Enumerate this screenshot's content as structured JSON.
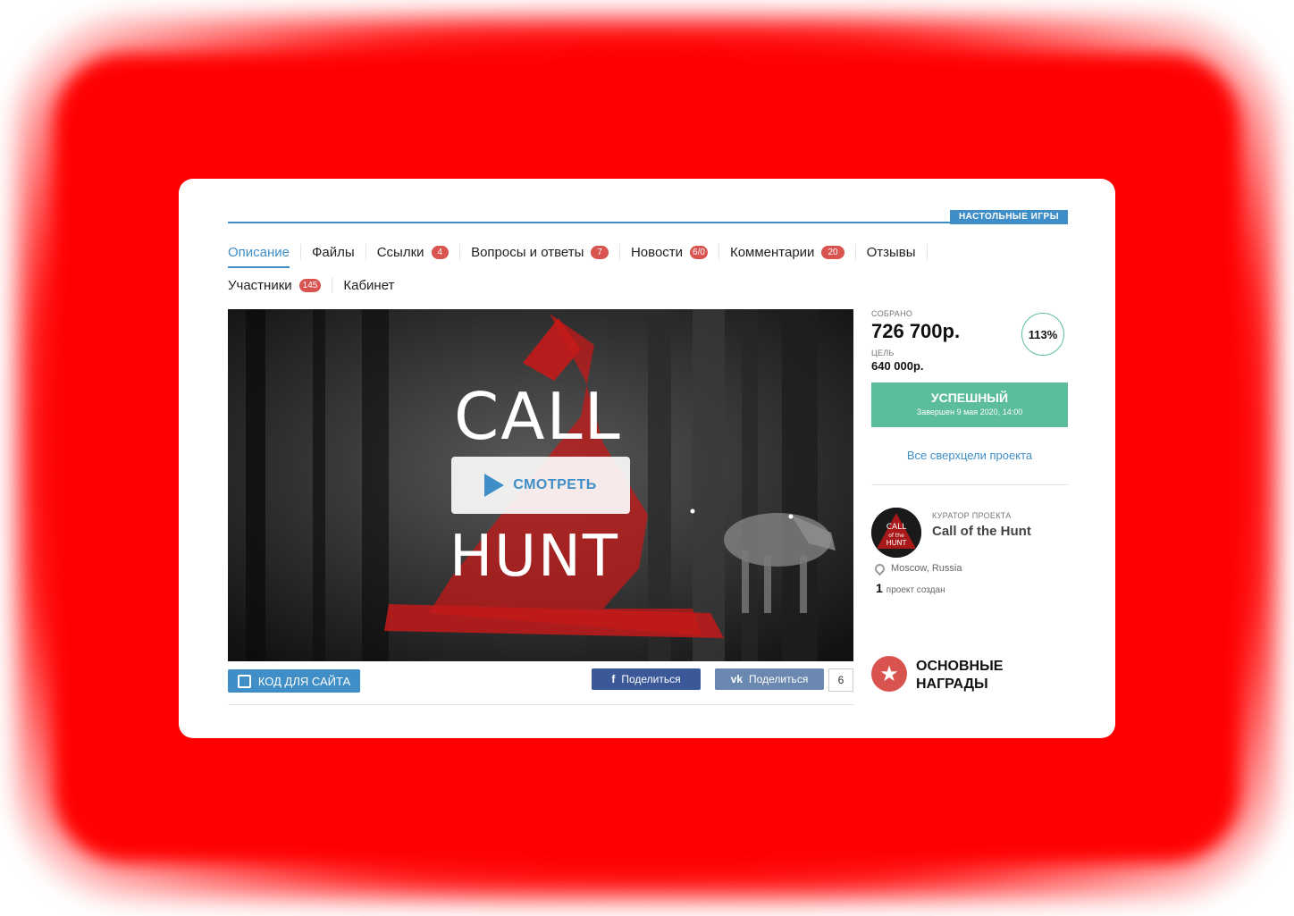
{
  "category": "НАСТОЛЬНЫЕ ИГРЫ",
  "tabs": [
    {
      "label": "Описание",
      "badge": null,
      "active": true
    },
    {
      "label": "Файлы",
      "badge": null
    },
    {
      "label": "Ссылки",
      "badge": "4"
    },
    {
      "label": "Вопросы и ответы",
      "badge": "7"
    },
    {
      "label": "Новости",
      "badge": "6/0"
    },
    {
      "label": "Комментарии",
      "badge": "20"
    },
    {
      "label": "Отзывы",
      "badge": null
    },
    {
      "label": "Участники",
      "badge": "145"
    },
    {
      "label": "Кабинет",
      "badge": null
    }
  ],
  "video": {
    "title_top": "CALL",
    "title_bottom": "HUNT",
    "watch_label": "СМОТРЕТЬ"
  },
  "actions": {
    "embed_label": "КОД ДЛЯ САЙТА",
    "fb_share": "Поделиться",
    "vk_share": "Поделиться",
    "vk_count": "6"
  },
  "funding": {
    "raised_caption": "СОБРАНО",
    "raised": "726 700р.",
    "goal_caption": "ЦЕЛЬ",
    "goal": "640 000р.",
    "percent": "113%",
    "status": "УСПЕШНЫЙ",
    "status_sub": "Завершен 9 мая 2020, 14:00",
    "stretch_link": "Все сверхцели проекта"
  },
  "curator": {
    "caption": "КУРАТОР ПРОЕКТА",
    "name": "Call of the Hunt",
    "location": "Moscow, Russia",
    "projects_count": "1",
    "projects_label": "проект создан",
    "avatar_top": "CALL",
    "avatar_mid": "of the",
    "avatar_bottom": "HUNT"
  },
  "rewards": {
    "title": "ОСНОВНЫЕ НАГРАДЫ"
  },
  "colors": {
    "accent": "#3f8ec7",
    "success": "#5cbd9b",
    "badge": "#d9534f",
    "glow": "#ff0000"
  }
}
